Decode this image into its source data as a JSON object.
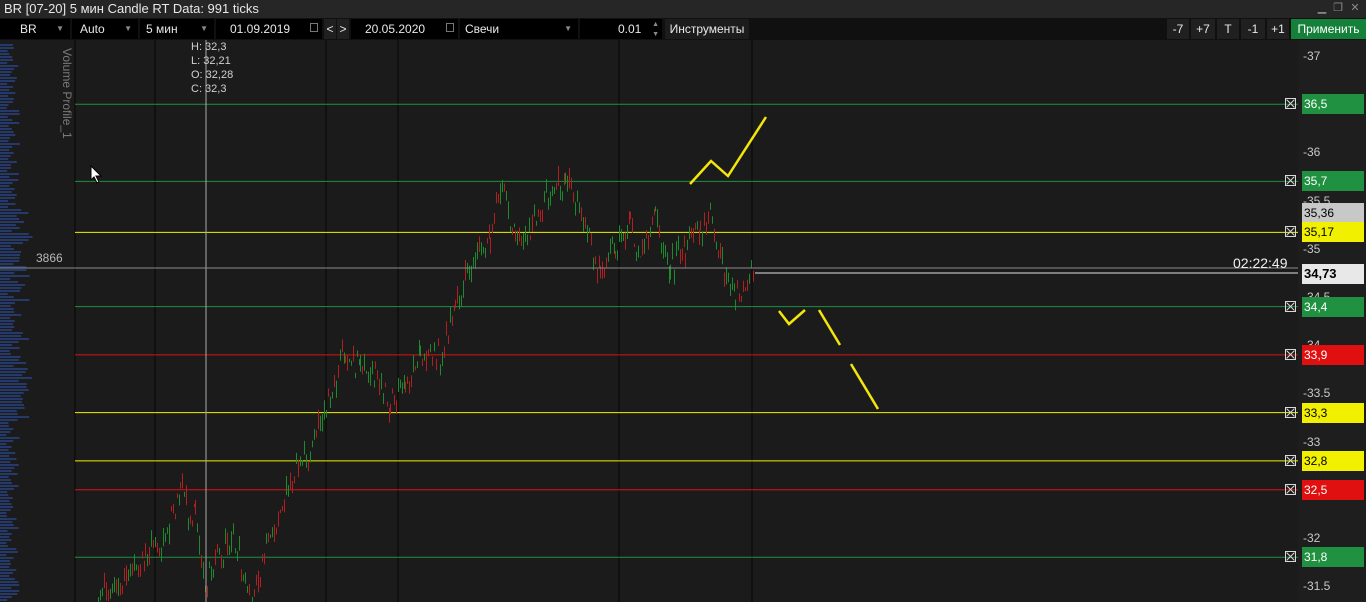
{
  "title": "BR [07-20] 5 мин Candle RT Data: 991 ticks",
  "toolbar": {
    "symbol": "BR",
    "mode": "Auto",
    "timeframe": "5 мин",
    "date_from": "01.09.2019",
    "nav_prev": "<",
    "nav_next": ">",
    "date_to": "20.05.2020",
    "chart_type": "Свечи",
    "step": "0.01",
    "instruments": "Инструменты",
    "btn_minus7": "-7",
    "btn_plus7": "+7",
    "btn_t": "T",
    "btn_minus1": "-1",
    "btn_plus1": "+1",
    "apply": "Применить"
  },
  "ohlc": {
    "high": "H: 32,3",
    "low": "L: 32,21",
    "open": "O: 32,28",
    "close": "C: 32,3"
  },
  "volume_profile_label": "Volume Profile_1",
  "volume_level": "3866",
  "timer": "02:22:49",
  "axis_ticks": [
    {
      "label": "-37",
      "value": 37
    },
    {
      "label": "-36",
      "value": 36
    },
    {
      "label": "-35.5",
      "value": 35.5
    },
    {
      "label": "-35",
      "value": 35
    },
    {
      "label": "-34.5",
      "value": 34.5
    },
    {
      "label": "-34",
      "value": 34
    },
    {
      "label": "-33.5",
      "value": 33.5
    },
    {
      "label": "-33",
      "value": 33
    },
    {
      "label": "-32",
      "value": 32
    },
    {
      "label": "-31.5",
      "value": 31.5
    }
  ],
  "levels": [
    {
      "label": "36,5",
      "value": 36.5,
      "color": "#1f9140",
      "text": "#ffffff"
    },
    {
      "label": "35,7",
      "value": 35.7,
      "color": "#1f9140",
      "text": "#ffffff"
    },
    {
      "label": "35,36",
      "value": 35.36,
      "color": "#c8c8c8",
      "text": "#000000"
    },
    {
      "label": "35,17",
      "value": 35.17,
      "color": "#f0f000",
      "text": "#000000"
    },
    {
      "label": "34,73",
      "value": 34.73,
      "color": "#e8e8e8",
      "text": "#000000"
    },
    {
      "label": "34,4",
      "value": 34.4,
      "color": "#1f9140",
      "text": "#ffffff"
    },
    {
      "label": "33,9",
      "value": 33.9,
      "color": "#e01010",
      "text": "#ffffff"
    },
    {
      "label": "33,3",
      "value": 33.3,
      "color": "#f0f000",
      "text": "#000000"
    },
    {
      "label": "32,8",
      "value": 32.8,
      "color": "#f0f000",
      "text": "#000000"
    },
    {
      "label": "32,5",
      "value": 32.5,
      "color": "#e01010",
      "text": "#ffffff"
    },
    {
      "label": "31,8",
      "value": 31.8,
      "color": "#1f9140",
      "text": "#ffffff"
    }
  ],
  "colors": {
    "up": "#1e8a2e",
    "down": "#b02020",
    "annotation": "#f5e60a"
  }
}
